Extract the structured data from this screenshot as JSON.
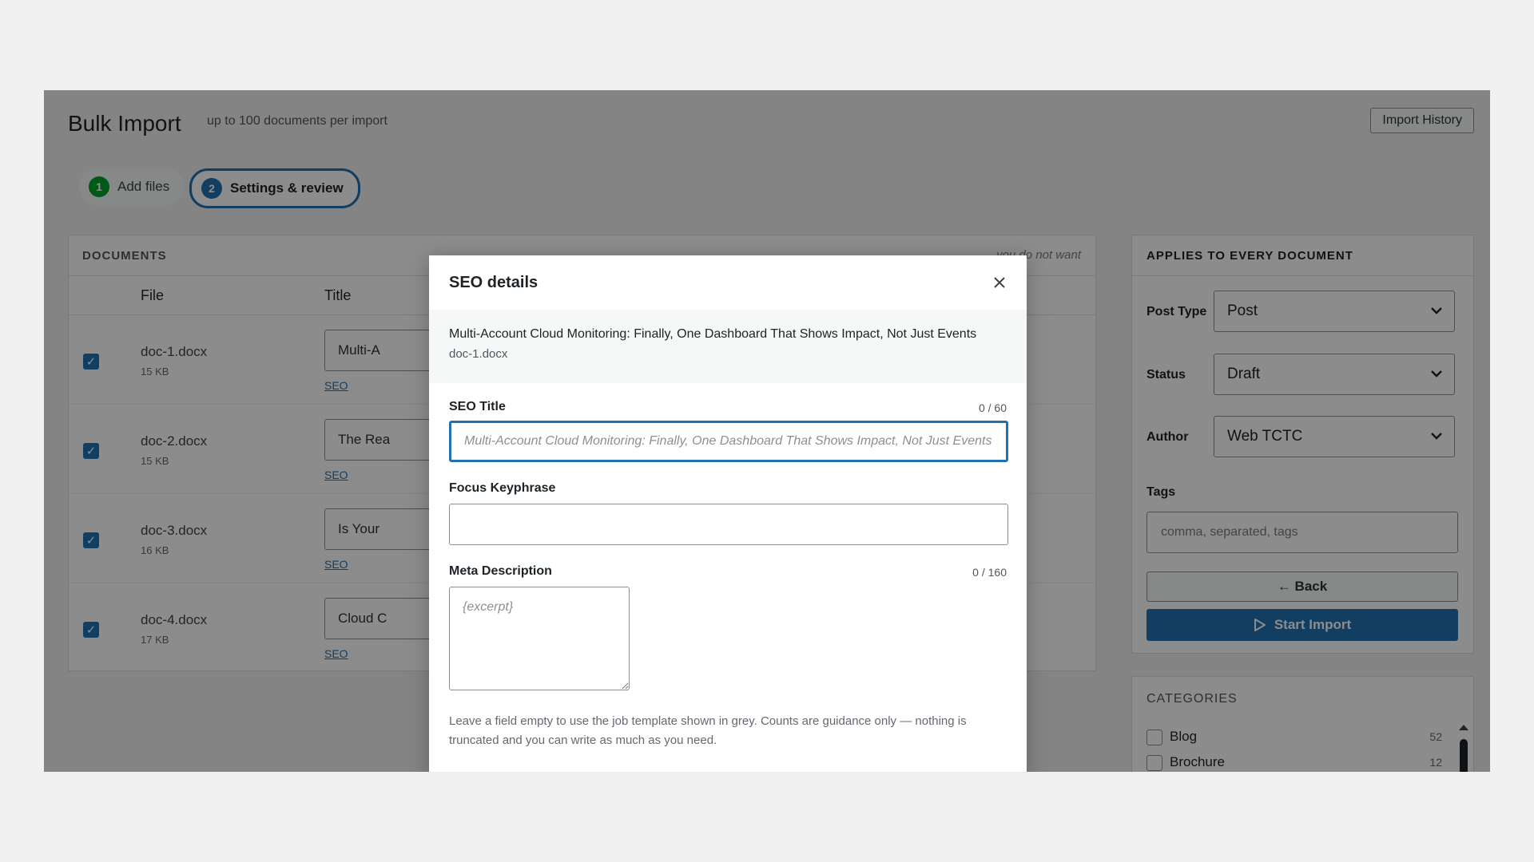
{
  "page": {
    "title": "Bulk Import",
    "subtitle": "up to 100 documents per import",
    "import_history_label": "Import History"
  },
  "steps": [
    {
      "num": "1",
      "label": "Add files"
    },
    {
      "num": "2",
      "label": "Settings & review"
    }
  ],
  "documents": {
    "heading": "DOCUMENTS",
    "hint": "you do not want",
    "col_file": "File",
    "col_title": "Title",
    "rows": [
      {
        "name": "doc-1.docx",
        "size": "15 KB",
        "title": "Multi-A",
        "seo": "SEO"
      },
      {
        "name": "doc-2.docx",
        "size": "15 KB",
        "title": "The Rea",
        "seo": "SEO"
      },
      {
        "name": "doc-3.docx",
        "size": "16 KB",
        "title": "Is Your",
        "seo": "SEO"
      },
      {
        "name": "doc-4.docx",
        "size": "17 KB",
        "title": "Cloud C",
        "seo": "SEO"
      }
    ]
  },
  "sidebar": {
    "heading": "APPLIES TO EVERY DOCUMENT",
    "post_type_label": "Post Type",
    "post_type_value": "Post",
    "status_label": "Status",
    "status_value": "Draft",
    "author_label": "Author",
    "author_value": "Web TCTC",
    "tags_label": "Tags",
    "tags_placeholder": "comma, separated, tags",
    "back_label": "← Back",
    "start_label": "Start Import"
  },
  "categories": {
    "heading": "CATEGORIES",
    "items": [
      {
        "label": "Blog",
        "count": "52"
      },
      {
        "label": "Brochure",
        "count": "12"
      }
    ]
  },
  "modal": {
    "title": "SEO details",
    "doc_title": "Multi-Account Cloud Monitoring: Finally, One Dashboard That Shows Impact, Not Just Events",
    "doc_file": "doc-1.docx",
    "seo_title_label": "SEO Title",
    "seo_title_count": "0 / 60",
    "seo_title_placeholder": "Multi-Account Cloud Monitoring: Finally, One Dashboard That Shows Impact, Not Just Events",
    "keyphrase_label": "Focus Keyphrase",
    "meta_label": "Meta Description",
    "meta_count": "0 / 160",
    "meta_placeholder": "{excerpt}",
    "help_text": "Leave a field empty to use the job template shown in grey. Counts are guidance only — nothing is truncated and you can write as much as you need."
  },
  "colors": {
    "accent": "#2271b1",
    "success": "#00a32a"
  }
}
